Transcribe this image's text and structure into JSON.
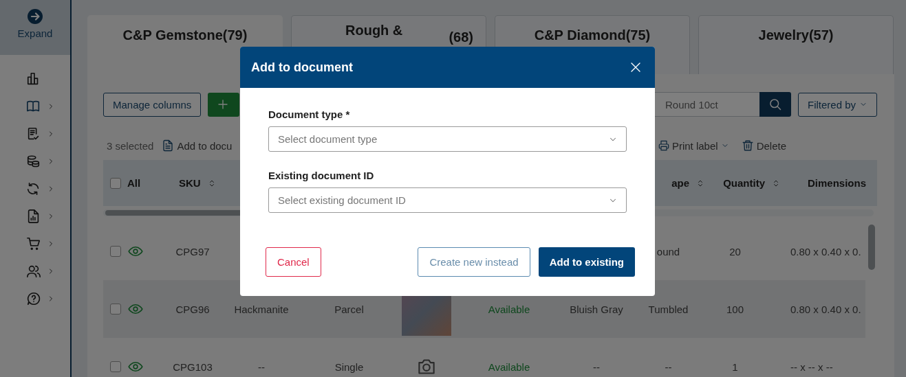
{
  "sidebar": {
    "expand_label": "Expand",
    "items": [
      {
        "expandable": false
      },
      {
        "expandable": true,
        "selected": true
      },
      {
        "expandable": true,
        "selected": false
      },
      {
        "expandable": true,
        "selected": false
      },
      {
        "expandable": true,
        "selected": false
      },
      {
        "expandable": true,
        "selected": false
      },
      {
        "expandable": true,
        "selected": false
      },
      {
        "expandable": true,
        "selected": false
      },
      {
        "expandable": true,
        "selected": false
      }
    ]
  },
  "tabs": [
    {
      "label": "C&P Gemstone(79)",
      "selected": true
    },
    {
      "label": "Rough &",
      "count": "(68)",
      "selected": false
    },
    {
      "label": "C&P Diamond(75)",
      "selected": false
    },
    {
      "label": "Jewelry(57)",
      "selected": false
    }
  ],
  "toolbar": {
    "manage_columns": "Manage columns",
    "search_placeholder": "Round 10ct",
    "filter": "Filtered by"
  },
  "selection_bar": {
    "count": "3 selected",
    "add_to_document": "Add to docu",
    "print_label": "Print label",
    "delete": "Delete"
  },
  "table": {
    "all_label": "All",
    "all_checked": false,
    "columns": [
      {
        "label": "SKU",
        "sortable": true
      },
      {
        "label": "ape",
        "sortable": true
      },
      {
        "label": "Quantity",
        "sortable": true
      },
      {
        "label": "Dimensions",
        "sortable": false
      }
    ],
    "rows": [
      {
        "checked": false,
        "sku": "CPG97",
        "name": "",
        "type": "",
        "status": "",
        "stone_color": "",
        "shape": "ound",
        "quantity": "20",
        "dimensions": "0.80 x 0.40 x 0."
      },
      {
        "checked": false,
        "sku": "CPG96",
        "name": "Hackmanite",
        "type": "Parcel",
        "image": {
          "kind": "photo"
        },
        "status": "Available",
        "stone_color": "Bluish Gray",
        "shape": "Tumbled",
        "quantity": "100",
        "dimensions": "0.80 x 0.40 x 0."
      },
      {
        "checked": false,
        "sku": "CPG103",
        "name": "--",
        "type": "Single",
        "image": {
          "kind": "camera"
        },
        "status": "Available",
        "stone_color": "--",
        "shape": "--",
        "quantity": "1",
        "dimensions": "-- x -- x --"
      }
    ]
  },
  "dialog": {
    "title": "Add to document",
    "fields": [
      {
        "label": "Document type *",
        "placeholder": "Select document type"
      },
      {
        "label": "Existing document ID",
        "placeholder": "Select existing document ID"
      }
    ],
    "cancel": "Cancel",
    "create_new": "Create new instead",
    "add_existing": "Add to existing"
  }
}
